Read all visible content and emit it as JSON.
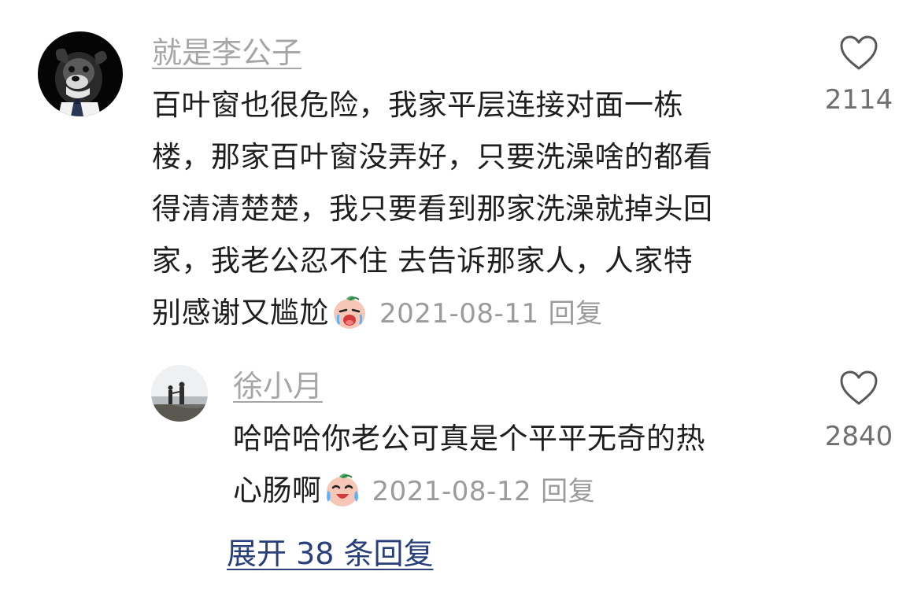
{
  "comment": {
    "username": "就是李公子",
    "avatar_icon": "dog-photo-avatar",
    "text_lines": [
      "百叶窗也很危险，我家平层连接对面一栋",
      "楼，那家百叶窗没弄好，只要洗澡啥的都看",
      "得清清楚楚，我只要看到那家洗澡就掉头回",
      "家，我老公忍不住 去告诉那家人，人家特",
      "别感谢又尴尬"
    ],
    "emoji": "crying-emoji",
    "date": "2021-08-11",
    "reply_label": "回复",
    "like_icon": "heart-icon",
    "like_count": "2114"
  },
  "reply": {
    "username": "徐小月",
    "avatar_icon": "beach-photo-avatar",
    "text_lines": [
      "哈哈哈你老公可真是个平平无奇的热",
      "心肠啊"
    ],
    "emoji": "laughing-tears-emoji",
    "date": "2021-08-12",
    "reply_label": "回复",
    "like_icon": "heart-icon",
    "like_count": "2840"
  },
  "expand_label": "展开 38 条回复",
  "colors": {
    "username": "#a6a6a6",
    "meta": "#9b9b9b",
    "link": "#283f7c",
    "text": "#1e1e1e"
  }
}
